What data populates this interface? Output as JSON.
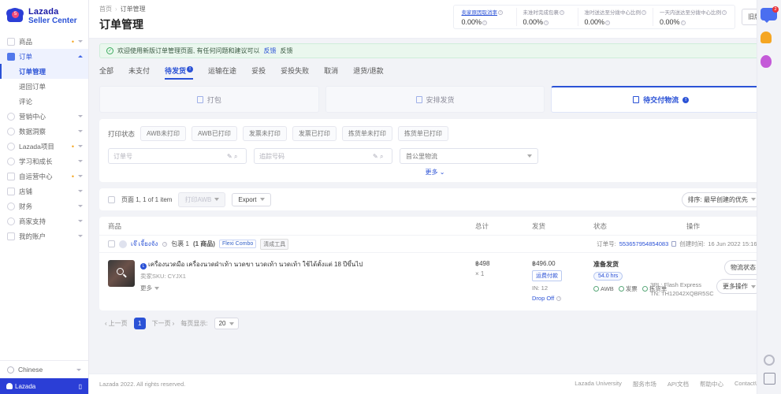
{
  "brand": {
    "line1": "Lazada",
    "line2": "Seller Center",
    "logo_badge": "5"
  },
  "sidebar": {
    "items": [
      {
        "label": "商品",
        "dot": "•",
        "expandable": true
      },
      {
        "label": "订单",
        "expandable": true,
        "active": true
      },
      {
        "label": "营销中心",
        "expandable": true
      },
      {
        "label": "数据洞察",
        "expandable": true
      },
      {
        "label": "Lazada项目",
        "dot": "•",
        "expandable": true
      },
      {
        "label": "学习和成长",
        "expandable": true
      },
      {
        "label": "自运营中心",
        "dot": "•",
        "expandable": true
      },
      {
        "label": "店铺",
        "expandable": true
      },
      {
        "label": "财务",
        "expandable": true
      },
      {
        "label": "商家支持",
        "expandable": true
      },
      {
        "label": "我的账户",
        "expandable": true
      }
    ],
    "sub_items": [
      {
        "label": "订单管理",
        "current": true
      },
      {
        "label": "退回订单",
        "current": false
      },
      {
        "label": "评论",
        "current": false
      }
    ],
    "language": "Chinese",
    "footer_brand": "Lazada"
  },
  "header": {
    "breadcrumb": {
      "root": "首页",
      "separator": "›",
      "current": "订单管理"
    },
    "title": "订单管理",
    "old_version_button": "旧版本",
    "metrics": [
      {
        "label": "卖家原因取消率",
        "value": "0.00%",
        "link": true
      },
      {
        "label": "未准时完成包裹",
        "value": "0.00%",
        "link": false
      },
      {
        "label": "准时送达至分拨中心比例",
        "value": "0.00%",
        "link": false
      },
      {
        "label": "一天内送达至分拨中心比例",
        "value": "0.00%",
        "link": false
      }
    ]
  },
  "notice": {
    "text": "欢迎使用新版订单管理页面, 有任何问题和建议可以",
    "link": "反馈",
    "suffix": "反馈"
  },
  "tabs": [
    {
      "label": "全部",
      "active": false
    },
    {
      "label": "未支付",
      "active": false
    },
    {
      "label": "待发货",
      "active": true,
      "badge": "!"
    },
    {
      "label": "运输在途",
      "active": false
    },
    {
      "label": "妥投",
      "active": false
    },
    {
      "label": "妥投失败",
      "active": false
    },
    {
      "label": "取消",
      "active": false
    },
    {
      "label": "退货/退款",
      "active": false
    }
  ],
  "steps": [
    {
      "label": "打包",
      "active": false
    },
    {
      "label": "安排发货",
      "active": false
    },
    {
      "label": "待交付物流",
      "active": true,
      "badge": "!"
    }
  ],
  "filters": {
    "print_status_label": "打印状态",
    "chips": [
      "AWB未打印",
      "AWB已打印",
      "发票未打印",
      "发票已打印",
      "拣货单未打印",
      "拣货单已打印"
    ],
    "order_no_placeholder": "订单号",
    "order_no_value": "",
    "tracking_placeholder": "追踪号码",
    "tracking_value": "",
    "logistics_select": "首公里物流",
    "more_label": "更多"
  },
  "toolbar": {
    "page_info": "页面 1, 1 of 1 item",
    "print_awb_label": "打印AWB",
    "export_label": "Export",
    "sort_label": "排序: 最早创建的优先"
  },
  "table": {
    "columns": [
      "商品",
      "总计",
      "发货",
      "状态",
      "操作"
    ],
    "order": {
      "buyer_name": "เจ๊ เจี้ยงจัง",
      "package_label": "包裹 1",
      "item_count": "(1 商品)",
      "tags": [
        "Flexi Combo",
        "清成工具"
      ],
      "order_no_label": "订单号:",
      "order_no": "553657954854083",
      "created_label": "创建时间:",
      "created_at": "16 Jun 2022 15:16",
      "product": {
        "title": "เครื่องนวดมือ เครื่องนวดฝ่าเท้า นวดขา นวดเท้า นวดเท้า ใช้ได้ตั้งแต่ 18 ปีขึ้นไป",
        "sku_label": "卖家SKU:",
        "sku": "CYJX1",
        "more_label": "更多"
      },
      "total": {
        "price_small": "฿498",
        "qty": "× 1"
      },
      "shipping": {
        "amount": "฿496.00",
        "pay_tag": "运费付款",
        "invoice": "IN: 12",
        "dropoff": "Drop Off"
      },
      "status": {
        "title": "准备发货",
        "hours_badge": "54.0 hrs",
        "carrier": "3PL: Flash Express",
        "tracking": "TN: TH12042XQBR5SC",
        "print_items": [
          "AWB",
          "发票",
          "拣货单"
        ]
      },
      "operations": {
        "logistics_button": "物流状态",
        "more_button": "更多操作"
      }
    }
  },
  "pagination": {
    "prev": "上一页",
    "current_page": "1",
    "next": "下一页",
    "size_label": "每页显示:",
    "size_value": "20"
  },
  "footer": {
    "copyright": "Lazada 2022. All rights reserved.",
    "links": [
      "Lazada University",
      "服务市场",
      "API文档",
      "帮助中心",
      "ContactUs"
    ]
  },
  "rail": {
    "chat_badge": "2",
    "bell_badge": "",
    "balloon_badge": ""
  },
  "colors": {
    "brand": "#2b3ed6",
    "accent": "#2b52d6",
    "success": "#3aab5e",
    "warning": "#f5a623"
  }
}
